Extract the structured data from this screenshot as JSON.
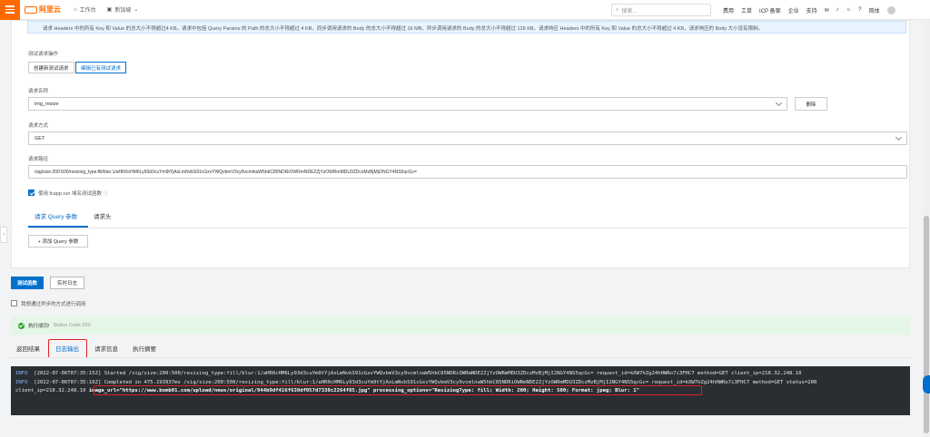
{
  "topbar": {
    "logo": "阿里云",
    "tabs": [
      "工作台",
      "新加坡"
    ],
    "search_placeholder": "搜索...",
    "right_items": [
      "费用",
      "工单",
      "ICP 备案",
      "企业",
      "支持",
      "简体"
    ]
  },
  "notice": "请求 Headers 中的所有 Key 和 Value 的总大小不得超过4 KB。请求中包括 Query Params 的 Path 的总大小不得超过 4 KB。同步调用请求的 Body 的总大小不得超过 16 MB，异步调用请求的 Body 的总大小不得超过 128 KB。请求响应 Headers 中的所有 Key 和 Value 的总大小不得超过 4 KB，请求响应的 Body 大小没有限制。",
  "request_op": {
    "label": "测试请求操作",
    "create_label": "创建新测试请求",
    "edit_label": "编辑已有测试请求"
  },
  "request_name": {
    "label": "请求名称",
    "value": "img_resize",
    "delete_label": "删除"
  },
  "method": {
    "label": "请求方式",
    "value": "GET"
  },
  "path": {
    "label": "请求路径",
    "value": "/sig/size:200:500/resizing_type:fill/blur:1/aHR0cHM6Ly93d3cuYm9tYjAxLmNvbS91cGxvYWQvbmV3cy9vcmlnaW5hbC85NDRiOWRmNDE2ZjYzOWRmMDU3ZDczMzBjMjI2NGY4NS5qcGc="
  },
  "fcapp": {
    "label": "使用 fcapp.run 域名测试函数"
  },
  "req_tabs": [
    "请求 Query 参数",
    "请求头"
  ],
  "add_query_label": "+ 添加 Query 参数",
  "actions": {
    "test_label": "测试函数",
    "log_label": "实时日志"
  },
  "async_label": "我想通过异步的方式进行调用",
  "success": {
    "label": "执行成功!",
    "code": "Status Code 200"
  },
  "result_tabs": [
    "返回结果",
    "日志输出",
    "请求信息",
    "执行摘要"
  ],
  "console_lines": [
    {
      "level": "INFO",
      "text": "[2022-07-06T07:35:15Z] Started /sig/size:200:500/resizing_type:fill/blur:1/aHR0cHM6Ly93d3cuYm9tYjAxLmNvbS91cGxvYWQvbmV3cy9vcmlnaW5hbC85NDRiOWRmNDE2ZjYzOWRmMDU3ZDczMzBjMjI2NGY4NS5qcGc=  request_id=kXW7hZg24hHWRo7i3FHC7 method=GET client_ip=218.32.248.10"
    },
    {
      "level": "INFO",
      "text": "[2022-07-06T07:35:16Z] Completed in 475.193937ms /sig/size:200:500/resizing_type:fill/blur:1/aHR0cHM6Ly93d3cuYm9tYjAxLmNvbS91cGxvYWQvbmV3cy9vcmlnaW5hbC85NDRiOWRmNDE2ZjYzOWRmMDU3ZDczMzBjMjI2NGY4NS5qcGc=  request_id=kXW7hZg24hHWRo7i3FHC7 method=GET status=200"
    },
    {
      "level": "",
      "prefix": "client_ip=218.32.248.10 ",
      "highlight": "image_url=\"https://www.bomb01.com/upload/news/original/944b9df416f639df057d7330c2264f85.jpg\" processing_options=\"ResizingType: fill; Width: 200; Height: 500; Format: jpeg; Blur: 1\""
    }
  ],
  "colors": {
    "brand": "#ff6a00",
    "primary": "#0070cc",
    "highlight_box": "#e02020",
    "console_bg": "#2a2e33",
    "success_bg": "#e4f6e5"
  }
}
